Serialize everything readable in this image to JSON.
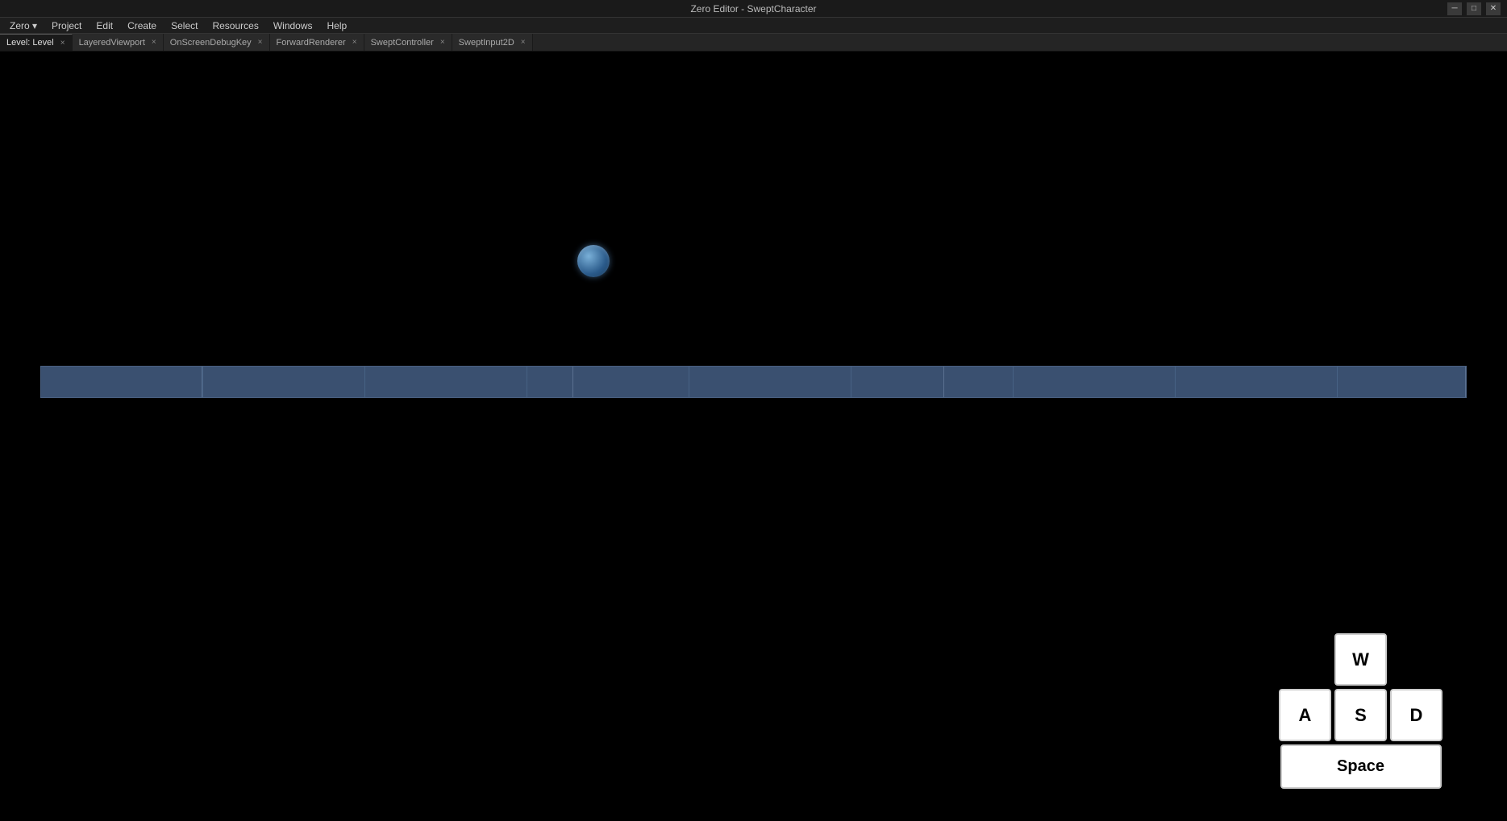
{
  "titleBar": {
    "title": "Zero Editor - SweptCharacter",
    "windowControls": {
      "minimize": "─",
      "maximize": "□",
      "close": "✕"
    }
  },
  "menuBar": {
    "items": [
      {
        "id": "zero",
        "label": "Zero ▾"
      },
      {
        "id": "project",
        "label": "Project"
      },
      {
        "id": "edit",
        "label": "Edit"
      },
      {
        "id": "create",
        "label": "Create"
      },
      {
        "id": "select",
        "label": "Select"
      },
      {
        "id": "resources",
        "label": "Resources"
      },
      {
        "id": "windows",
        "label": "Windows"
      },
      {
        "id": "help",
        "label": "Help"
      }
    ]
  },
  "tabBar": {
    "tabs": [
      {
        "id": "level",
        "label": "Level: Level",
        "active": true,
        "closable": true
      },
      {
        "id": "layered",
        "label": "LayeredViewport",
        "active": false,
        "closable": true
      },
      {
        "id": "debugkey",
        "label": "OnScreenDebugKey",
        "active": false,
        "closable": true
      },
      {
        "id": "forward",
        "label": "ForwardRenderer",
        "active": false,
        "closable": true
      },
      {
        "id": "controller",
        "label": "SweptController",
        "active": false,
        "closable": true
      },
      {
        "id": "input2d",
        "label": "SweptInput2D",
        "active": false,
        "closable": true
      }
    ]
  },
  "viewport": {
    "background": "#000000"
  },
  "keyDisplay": {
    "keys": {
      "w": "W",
      "a": "A",
      "s": "S",
      "d": "D",
      "space": "Space"
    }
  }
}
